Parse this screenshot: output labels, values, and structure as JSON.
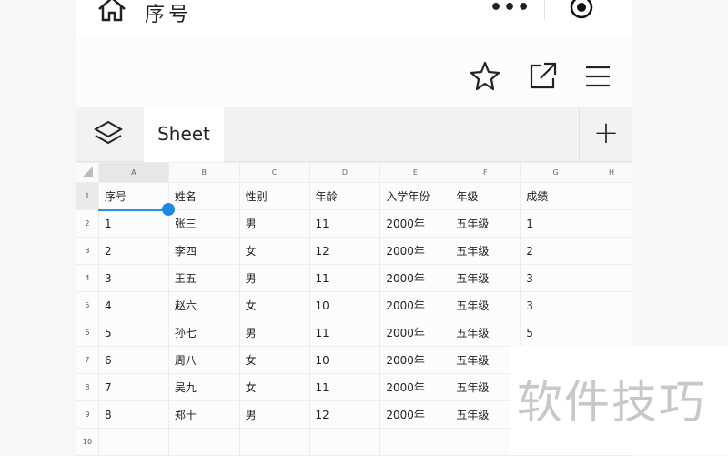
{
  "header": {
    "title": "序号",
    "more_icon": "more-dots-icon",
    "record_icon": "record-icon"
  },
  "actions": {
    "star": "star-icon",
    "share": "share-icon",
    "menu": "menu-icon"
  },
  "toolbar": {
    "sheet_tab": "Sheet",
    "add_label": "+"
  },
  "grid": {
    "columns": [
      "A",
      "B",
      "C",
      "D",
      "E",
      "F",
      "G",
      "H"
    ],
    "row_numbers": [
      "1",
      "2",
      "3",
      "4",
      "5",
      "6",
      "7",
      "8",
      "9",
      "10"
    ],
    "rows": [
      [
        "序号",
        "姓名",
        "性别",
        "年龄",
        "入学年份",
        "年级",
        "成绩"
      ],
      [
        "1",
        "张三",
        "男",
        "11",
        "2000年",
        "五年级",
        "1"
      ],
      [
        "2",
        "李四",
        "女",
        "12",
        "2000年",
        "五年级",
        "2"
      ],
      [
        "3",
        "王五",
        "男",
        "11",
        "2000年",
        "五年级",
        "3"
      ],
      [
        "4",
        "赵六",
        "女",
        "10",
        "2000年",
        "五年级",
        "3"
      ],
      [
        "5",
        "孙七",
        "男",
        "11",
        "2000年",
        "五年级",
        "5"
      ],
      [
        "6",
        "周八",
        "女",
        "10",
        "2000年",
        "五年级",
        ""
      ],
      [
        "7",
        "吴九",
        "女",
        "11",
        "2000年",
        "五年级",
        ""
      ],
      [
        "8",
        "郑十",
        "男",
        "12",
        "2000年",
        "五年级",
        ""
      ],
      [
        "",
        "",
        "",
        "",
        "",
        "",
        ""
      ]
    ]
  },
  "watermark": "软件技巧",
  "colors": {
    "accent": "#1e88e5"
  }
}
